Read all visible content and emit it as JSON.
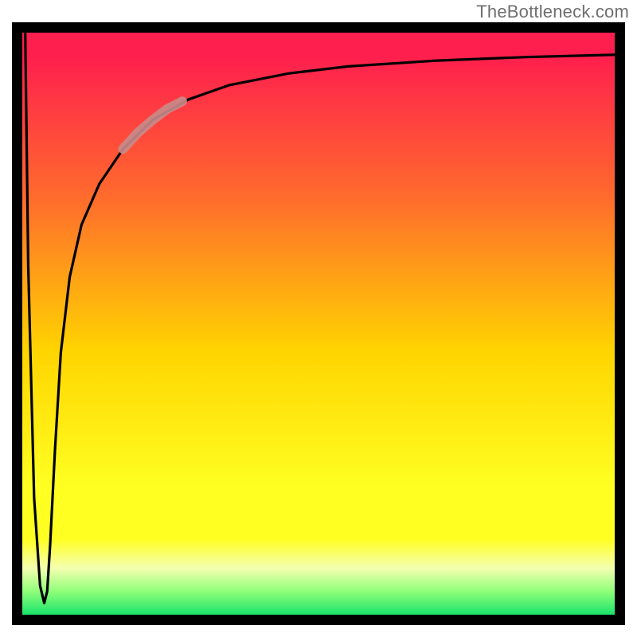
{
  "attribution": "TheBottleneck.com",
  "colors": {
    "top": "#ff1f4e",
    "upper": "#ff6a2d",
    "mid": "#ffd500",
    "low": "#ffff22",
    "pale": "#f4ffb0",
    "green1": "#8fff7a",
    "green2": "#19e36b",
    "curve": "#000000",
    "highlight": "#c98b8b"
  },
  "chart_data": {
    "type": "line",
    "xlabel": "",
    "ylabel": "",
    "xlim": [
      0,
      100
    ],
    "ylim": [
      0,
      100
    ],
    "title": "",
    "series": [
      {
        "name": "bottleneck-curve",
        "x": [
          0.5,
          1.0,
          2.0,
          3.0,
          3.7,
          4.2,
          4.7,
          5.5,
          6.5,
          8,
          10,
          13,
          17,
          22,
          28,
          35,
          45,
          55,
          70,
          85,
          100
        ],
        "values": [
          100,
          60,
          20,
          5,
          2,
          4,
          12,
          28,
          45,
          58,
          67,
          74,
          80,
          85,
          88.5,
          91,
          93,
          94.2,
          95.2,
          95.8,
          96.2
        ]
      },
      {
        "name": "highlight-segment",
        "x": [
          17,
          19.5,
          22,
          24.5,
          27
        ],
        "values": [
          80,
          82.8,
          85,
          86.9,
          88.2
        ]
      }
    ]
  }
}
